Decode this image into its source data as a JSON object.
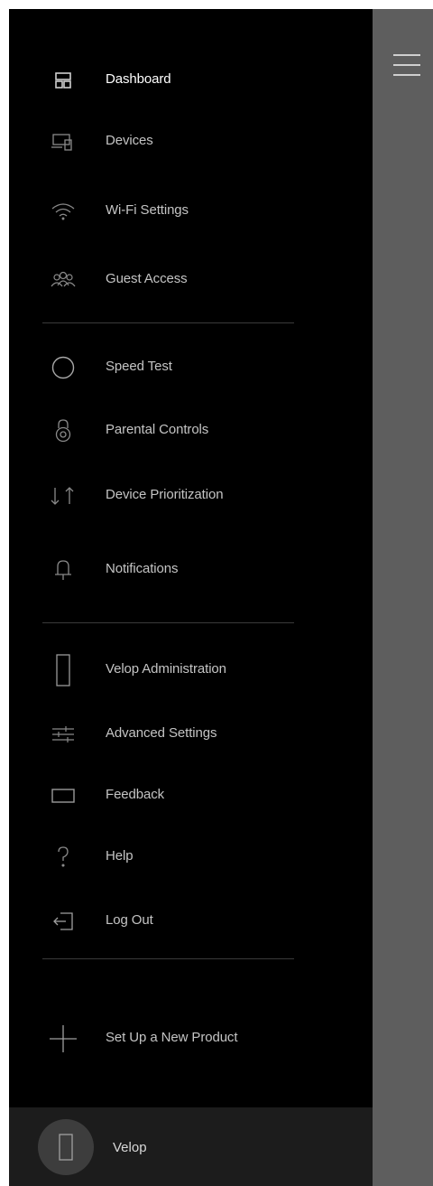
{
  "menu": {
    "items": [
      {
        "label": "Dashboard",
        "icon": "dashboard-icon"
      },
      {
        "label": "Devices",
        "icon": "devices-icon"
      },
      {
        "label": "Wi-Fi Settings",
        "icon": "wifi-icon"
      },
      {
        "label": "Guest Access",
        "icon": "guest-access-icon"
      },
      {
        "label": "Speed Test",
        "icon": "speed-test-icon"
      },
      {
        "label": "Parental Controls",
        "icon": "lock-icon"
      },
      {
        "label": "Device Prioritization",
        "icon": "priority-arrows-icon"
      },
      {
        "label": "Notifications",
        "icon": "bell-icon"
      },
      {
        "label": "Velop Administration",
        "icon": "node-icon"
      },
      {
        "label": "Advanced Settings",
        "icon": "sliders-icon"
      },
      {
        "label": "Feedback",
        "icon": "feedback-icon"
      },
      {
        "label": "Help",
        "icon": "question-icon"
      },
      {
        "label": "Log Out",
        "icon": "logout-icon"
      },
      {
        "label": "Set Up a New Product",
        "icon": "plus-icon"
      }
    ],
    "active_item": "Dashboard"
  },
  "footer": {
    "network_name": "Velop",
    "icon": "node-icon"
  },
  "header": {
    "menu_icon": "hamburger-icon"
  },
  "colors": {
    "drawer_bg": "#000000",
    "overlay": "#5e5e5e",
    "footer_bg": "#1c1c1c",
    "text": "#c4c4c4",
    "active_text": "#ffffff"
  }
}
